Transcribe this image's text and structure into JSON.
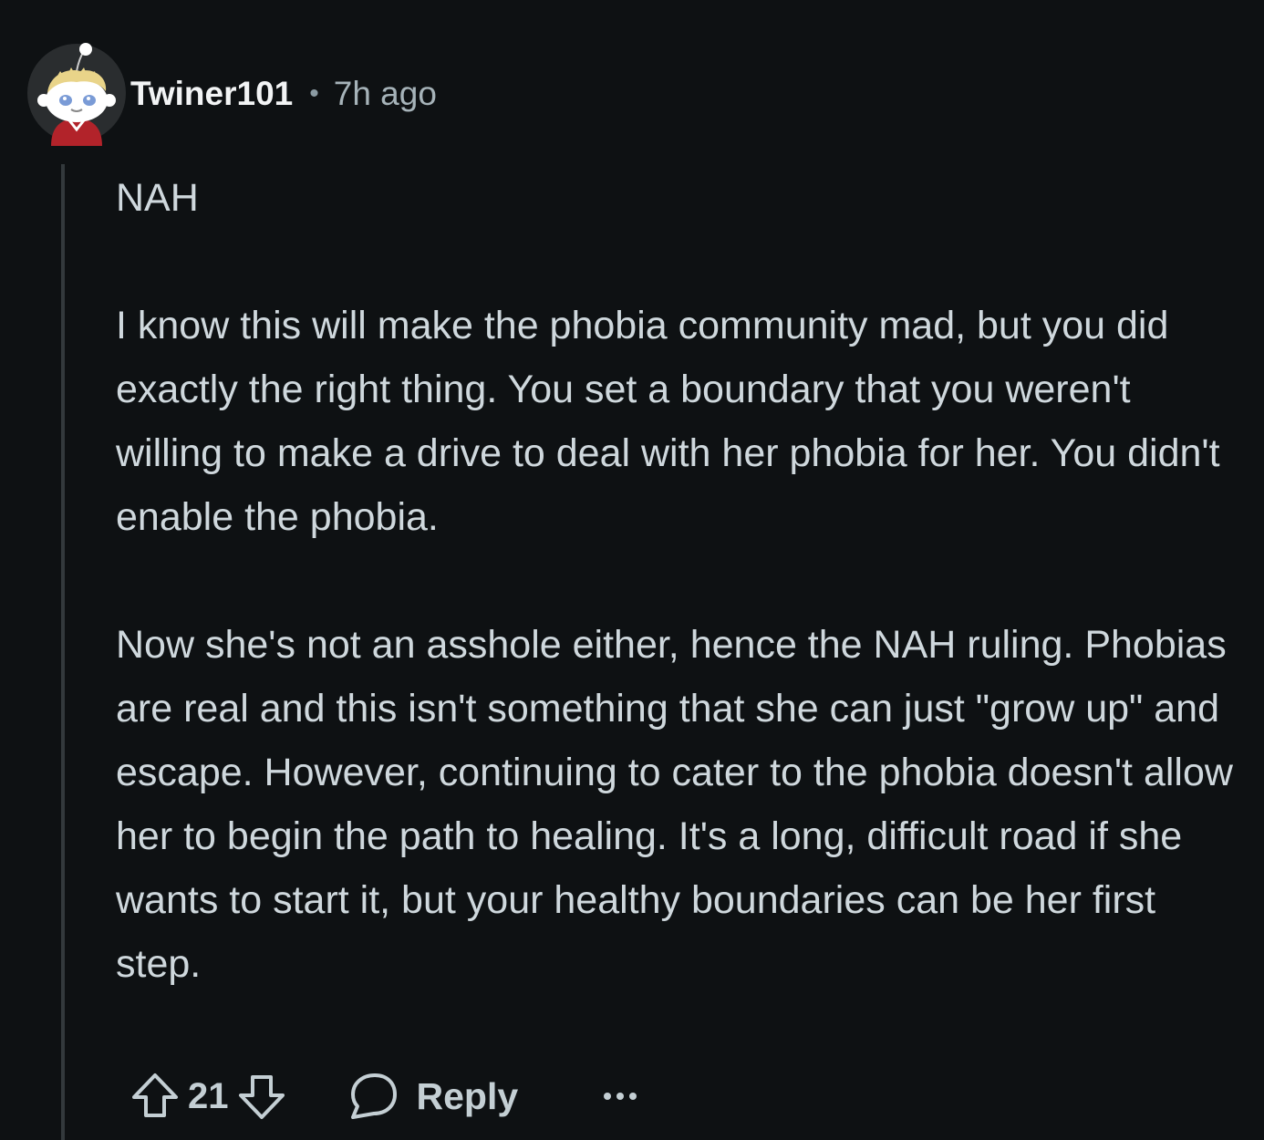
{
  "comment": {
    "author": "Twiner101",
    "separator": "•",
    "time": "7h ago",
    "paragraphs": [
      "NAH",
      "I know this will make the phobia community mad, but you did exactly the right thing. You set a boundary that you weren't willing to make a drive to deal with her phobia for her. You didn't enable the phobia.",
      "Now she's not an asshole either, hence the NAH ruling. Phobias are real and this isn't something that she can just \"grow up\" and escape. However, continuing to cater to the phobia doesn't allow her to begin the path to healing. It's a long, difficult road if she wants to start it, but your healthy boundaries can be her first step."
    ]
  },
  "actions": {
    "score": "21",
    "reply_label": "Reply",
    "upvote_icon": "upvote-arrow-icon",
    "downvote_icon": "downvote-arrow-icon",
    "reply_icon": "speech-bubble-icon",
    "more_icon": "ellipsis-icon"
  },
  "colors": {
    "background": "#0e1113",
    "text": "#cfd8dd",
    "username": "#f2f4f5",
    "muted": "#a6b3b9",
    "thread_line": "#33393c"
  }
}
